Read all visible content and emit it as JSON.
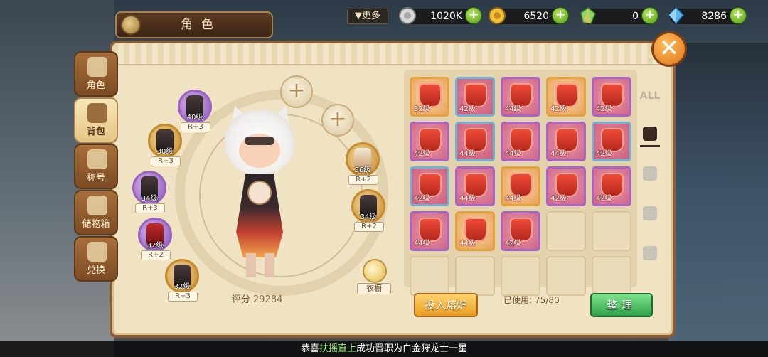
{
  "title": "角色",
  "topbar": {
    "more_label": "▼更多",
    "resources": [
      {
        "name": "silver",
        "value": "1020K",
        "icon": "silver-coin-icon",
        "color": "#c8c8c8"
      },
      {
        "name": "gold",
        "value": "6520",
        "icon": "gold-coin-icon",
        "color": "#e3b02c"
      },
      {
        "name": "crystal",
        "value": "0",
        "icon": "rainbow-crystal-icon",
        "color": "#7fd35c"
      },
      {
        "name": "diamond",
        "value": "8286",
        "icon": "blue-diamond-icon",
        "color": "#4fa7e8"
      }
    ]
  },
  "side_tabs": [
    {
      "label": "角色",
      "icon": "character-icon"
    },
    {
      "label": "背包",
      "icon": "bag-icon",
      "active": true
    },
    {
      "label": "称号",
      "icon": "title-icon"
    },
    {
      "label": "储物箱",
      "icon": "storage-icon"
    },
    {
      "label": "兑换",
      "icon": "exchange-icon"
    }
  ],
  "equipment": [
    {
      "slot": "top-left",
      "level": "40级",
      "rank": "R+3",
      "quality": "purple"
    },
    {
      "slot": "left-upper",
      "level": "30级",
      "rank": "R+3",
      "quality": "gold"
    },
    {
      "slot": "left-middle",
      "level": "34级",
      "rank": "R+3",
      "quality": "purple"
    },
    {
      "slot": "left-lower",
      "level": "32级",
      "rank": "R+2",
      "quality": "purple"
    },
    {
      "slot": "bottom-left",
      "level": "32级",
      "rank": "R+3",
      "quality": "gold"
    },
    {
      "slot": "right-upper",
      "level": "36级",
      "rank": "R+2",
      "quality": "gold"
    },
    {
      "slot": "right-lower",
      "level": "34级",
      "rank": "R+2",
      "quality": "gold"
    }
  ],
  "score": {
    "label": "评分",
    "value": "29284"
  },
  "wardrobe_label": "衣橱",
  "inventory": {
    "slots": [
      {
        "level": "32级",
        "quality": "gold"
      },
      {
        "level": "42级",
        "quality": "blue"
      },
      {
        "level": "44级",
        "quality": "purple"
      },
      {
        "level": "42级",
        "quality": "gold"
      },
      {
        "level": "42级",
        "quality": "purple"
      },
      {
        "level": "42级",
        "quality": "purple"
      },
      {
        "level": "44级",
        "quality": "blue"
      },
      {
        "level": "44级",
        "quality": "purple"
      },
      {
        "level": "44级",
        "quality": "purple"
      },
      {
        "level": "42级",
        "quality": "blue"
      },
      {
        "level": "42级",
        "quality": "blue"
      },
      {
        "level": "44级",
        "quality": "purple"
      },
      {
        "level": "44级",
        "quality": "gold"
      },
      {
        "level": "42级",
        "quality": "purple"
      },
      {
        "level": "42级",
        "quality": "purple"
      },
      {
        "level": "44级",
        "quality": "purple"
      },
      {
        "level": "44级",
        "quality": "gold"
      },
      {
        "level": "42级",
        "quality": "purple"
      },
      {
        "level": "",
        "quality": "empty"
      },
      {
        "level": "",
        "quality": "empty"
      },
      {
        "level": "",
        "quality": "empty"
      },
      {
        "level": "",
        "quality": "empty"
      },
      {
        "level": "",
        "quality": "empty"
      },
      {
        "level": "",
        "quality": "empty"
      },
      {
        "level": "",
        "quality": "empty"
      }
    ],
    "filters": [
      {
        "label": "ALL"
      },
      {
        "icon": "armor-filter-icon",
        "active": true
      },
      {
        "icon": "accessory-filter-icon"
      },
      {
        "icon": "material-filter-icon"
      },
      {
        "icon": "mount-filter-icon"
      }
    ]
  },
  "actions": {
    "smelt_label": "投入熔炉",
    "used_label": "已使用:",
    "used_value": "75/80",
    "sort_label": "整理"
  },
  "ticker": {
    "prefix": "恭喜",
    "name": "扶摇直上",
    "suffix": "成功晋职为白金狩龙士一星"
  }
}
